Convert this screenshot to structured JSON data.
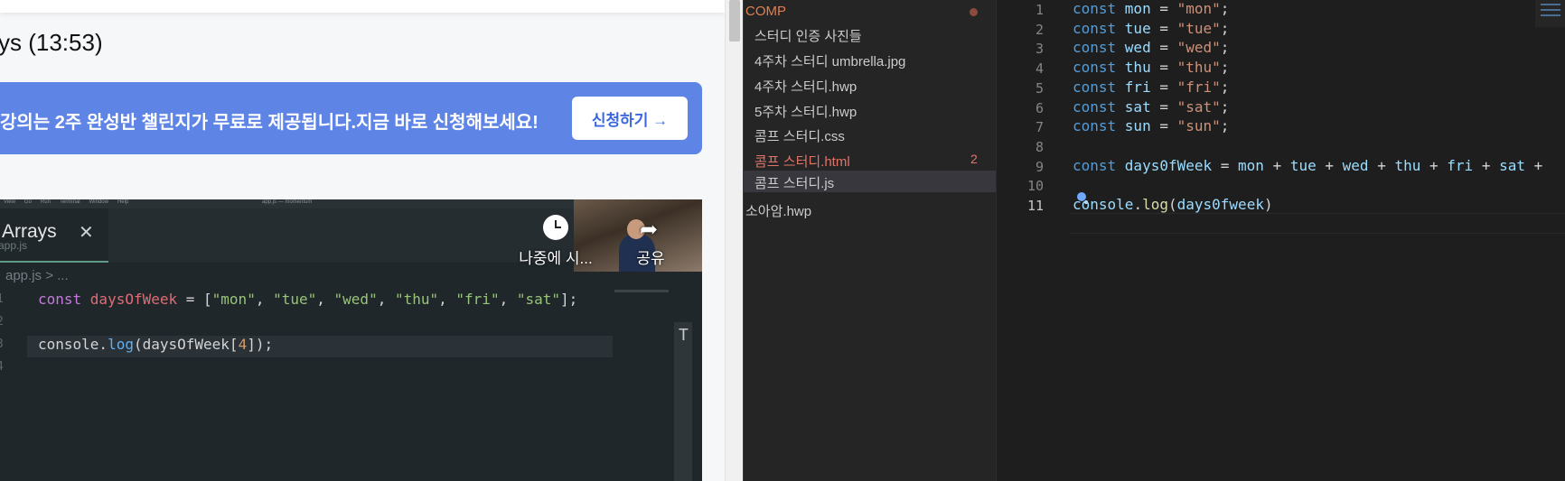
{
  "lecture": {
    "title": "ys (13:53)",
    "promo_text": "강의는 2주 완성반 챌린지가 무료로 제공됩니다.지금 바로 신청해보세요!",
    "promo_button": "신청하기 →",
    "promo_color": "#5e84e6"
  },
  "video": {
    "menubar": [
      "",
      "View",
      "Go",
      "Run",
      "Terminal",
      "Window",
      "Help"
    ],
    "window_title": "app.js — momentum",
    "tab_label": "Arrays",
    "tab_ghost": "app.js",
    "breadcrumb": "app.js > ...",
    "watch_later_label": "나중에 시...",
    "share_label": "공유",
    "scroll_glyph": "T",
    "lines": [
      {
        "num": "1",
        "parts": [
          [
            "kw",
            "const "
          ],
          [
            "var",
            "daysOfWeek"
          ],
          [
            "plain",
            " = ["
          ],
          [
            "str",
            "\"mon\""
          ],
          [
            "plain",
            ", "
          ],
          [
            "str",
            "\"tue\""
          ],
          [
            "plain",
            ", "
          ],
          [
            "str",
            "\"wed\""
          ],
          [
            "plain",
            ", "
          ],
          [
            "str",
            "\"thu\""
          ],
          [
            "plain",
            ", "
          ],
          [
            "str",
            "\"fri\""
          ],
          [
            "plain",
            ", "
          ],
          [
            "str",
            "\"sat\""
          ],
          [
            "plain",
            "];"
          ]
        ]
      },
      {
        "num": "2",
        "parts": []
      },
      {
        "num": "3",
        "parts": [
          [
            "plain",
            "console."
          ],
          [
            "fn",
            "log"
          ],
          [
            "plain",
            "(daysOfWeek["
          ],
          [
            "num",
            "4"
          ],
          [
            "plain",
            "]);"
          ]
        ]
      },
      {
        "num": "4",
        "parts": []
      }
    ]
  },
  "explorer": {
    "folder": "COMP",
    "files": [
      {
        "prefix": "",
        "label": "스터디 인증 사진들",
        "state": "normal"
      },
      {
        "prefix": "",
        "label": "4주차 스터디 umbrella.jpg",
        "state": "normal"
      },
      {
        "prefix": "",
        "label": "4주차 스터디.hwp",
        "state": "normal"
      },
      {
        "prefix": "",
        "label": "5주차 스터디.hwp",
        "state": "normal"
      },
      {
        "prefix": "",
        "label": "콤프 스터디.css",
        "state": "normal"
      },
      {
        "prefix": "",
        "label": "콤프 스터디.html",
        "state": "error",
        "badge": "2"
      },
      {
        "prefix": "",
        "label": "콤프 스터디.js",
        "state": "selected"
      },
      {
        "prefix": "",
        "label": "소아암.hwp",
        "state": "normal"
      }
    ]
  },
  "editor": {
    "active_line": "11",
    "lines": [
      {
        "num": "1",
        "parts": [
          [
            "kw",
            "const "
          ],
          [
            "id",
            "mon"
          ],
          [
            "plain",
            " = "
          ],
          [
            "str",
            "\"mon\""
          ],
          [
            "plain",
            ";"
          ]
        ]
      },
      {
        "num": "2",
        "parts": [
          [
            "kw",
            "const "
          ],
          [
            "id",
            "tue"
          ],
          [
            "plain",
            " = "
          ],
          [
            "str",
            "\"tue\""
          ],
          [
            "plain",
            ";"
          ]
        ]
      },
      {
        "num": "3",
        "parts": [
          [
            "kw",
            "const "
          ],
          [
            "id",
            "wed"
          ],
          [
            "plain",
            " = "
          ],
          [
            "str",
            "\"wed\""
          ],
          [
            "plain",
            ";"
          ]
        ]
      },
      {
        "num": "4",
        "parts": [
          [
            "kw",
            "const "
          ],
          [
            "id",
            "thu"
          ],
          [
            "plain",
            " = "
          ],
          [
            "str",
            "\"thu\""
          ],
          [
            "plain",
            ";"
          ]
        ]
      },
      {
        "num": "5",
        "parts": [
          [
            "kw",
            "const "
          ],
          [
            "id",
            "fri"
          ],
          [
            "plain",
            " = "
          ],
          [
            "str",
            "\"fri\""
          ],
          [
            "plain",
            ";"
          ]
        ]
      },
      {
        "num": "6",
        "parts": [
          [
            "kw",
            "const "
          ],
          [
            "id",
            "sat"
          ],
          [
            "plain",
            " = "
          ],
          [
            "str",
            "\"sat\""
          ],
          [
            "plain",
            ";"
          ]
        ]
      },
      {
        "num": "7",
        "parts": [
          [
            "kw",
            "const "
          ],
          [
            "id",
            "sun"
          ],
          [
            "plain",
            " = "
          ],
          [
            "str",
            "\"sun\""
          ],
          [
            "plain",
            ";"
          ]
        ]
      },
      {
        "num": "8",
        "parts": []
      },
      {
        "num": "9",
        "parts": [
          [
            "kw",
            "const "
          ],
          [
            "id",
            "days0fWeek"
          ],
          [
            "plain",
            " = "
          ],
          [
            "id",
            "mon"
          ],
          [
            "plain",
            " + "
          ],
          [
            "id",
            "tue"
          ],
          [
            "plain",
            " + "
          ],
          [
            "id",
            "wed"
          ],
          [
            "plain",
            " + "
          ],
          [
            "id",
            "thu"
          ],
          [
            "plain",
            " + "
          ],
          [
            "id",
            "fri"
          ],
          [
            "plain",
            " + "
          ],
          [
            "id",
            "sat"
          ],
          [
            "plain",
            " +"
          ]
        ]
      },
      {
        "num": "10",
        "parts": []
      },
      {
        "num": "11",
        "parts": [
          [
            "id",
            "console"
          ],
          [
            "plain",
            "."
          ],
          [
            "fn",
            "log"
          ],
          [
            "plain",
            "("
          ],
          [
            "id",
            "days0fweek"
          ],
          [
            "plain",
            ")"
          ]
        ]
      }
    ]
  }
}
